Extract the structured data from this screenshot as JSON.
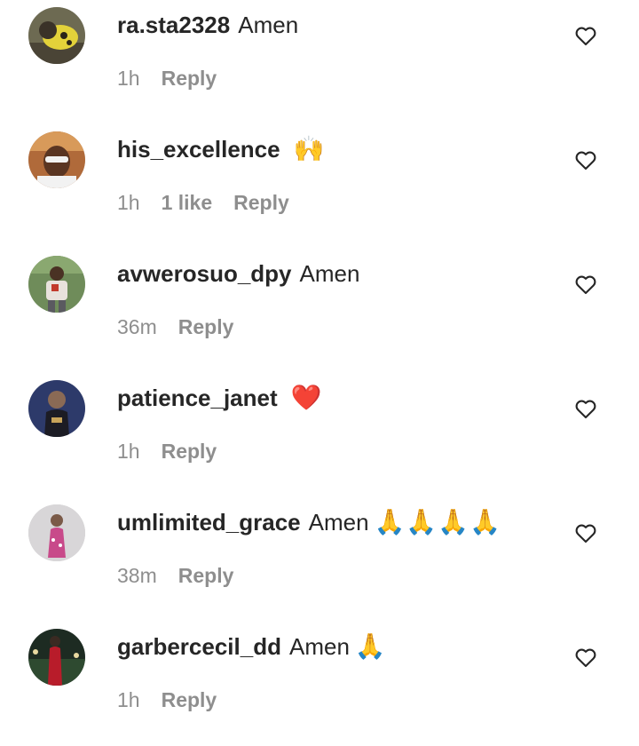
{
  "comments": [
    {
      "username": "ra.sta2328",
      "text": "Amen",
      "emoji": "",
      "time": "1h",
      "likes": "",
      "reply_label": "Reply",
      "avatar_colors": [
        "#6d6a52",
        "#e3d23a",
        "#3a3228"
      ]
    },
    {
      "username": "his_excellence",
      "text": "",
      "emoji": "🙌",
      "time": "1h",
      "likes": "1 like",
      "reply_label": "Reply",
      "avatar_colors": [
        "#b06a3a",
        "#f2f2f2",
        "#5a3522"
      ]
    },
    {
      "username": "avwerosuo_dpy",
      "text": "Amen",
      "emoji": "",
      "time": "36m",
      "likes": "",
      "reply_label": "Reply",
      "avatar_colors": [
        "#6f8c5a",
        "#e8e2dc",
        "#c23a2c"
      ]
    },
    {
      "username": "patience_janet",
      "text": "",
      "emoji": "❤️",
      "time": "1h",
      "likes": "",
      "reply_label": "Reply",
      "avatar_colors": [
        "#2d3a6a",
        "#1c1c24",
        "#8a6a55"
      ]
    },
    {
      "username": "umlimited_grace",
      "text": "Amen",
      "emoji": "🙏🙏🙏🙏",
      "time": "38m",
      "likes": "",
      "reply_label": "Reply",
      "avatar_colors": [
        "#d8d6d8",
        "#c84a8a",
        "#7a5a48"
      ]
    },
    {
      "username": "garbercecil_dd",
      "text": "Amen",
      "emoji": "🙏",
      "time": "1h",
      "likes": "",
      "reply_label": "Reply",
      "avatar_colors": [
        "#1d2b22",
        "#b81c2a",
        "#3a2a22"
      ]
    }
  ],
  "icons": {
    "like": "heart-outline-icon"
  },
  "colors": {
    "text_primary": "#262626",
    "text_secondary": "#8e8e8e",
    "background": "#ffffff"
  }
}
